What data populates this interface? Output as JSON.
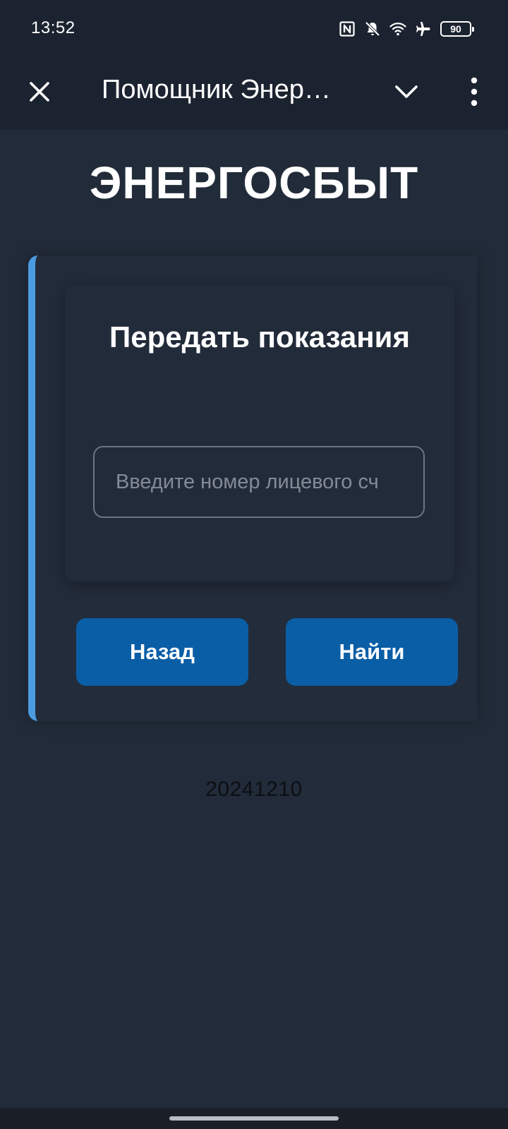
{
  "status_bar": {
    "time": "13:52",
    "icons": [
      "nfc-icon",
      "bell-muted-icon",
      "wifi-icon",
      "airplane-icon"
    ],
    "battery": "90"
  },
  "toolbar": {
    "title": "Помощник Энер…",
    "icons": [
      "close-icon",
      "chevron-down-icon",
      "more-vert-icon"
    ]
  },
  "main": {
    "brand": "ЭНЕРГОСБЫТ",
    "card": {
      "title": "Передать показания",
      "input": {
        "value": "",
        "placeholder": "Введите номер лицевого сч"
      },
      "back_label": "Назад",
      "find_label": "Найти"
    },
    "version": "20241210"
  },
  "colors": {
    "background": "#222b39",
    "bar": "#1c2330",
    "accent": "#4a9be0",
    "button": "#0a5ea6"
  }
}
